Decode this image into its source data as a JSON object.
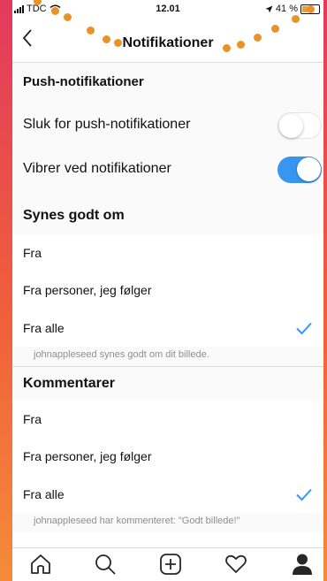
{
  "status_bar": {
    "carrier": "TDC",
    "time": "12.01",
    "battery": "41 %",
    "battery_level": 0.41
  },
  "nav": {
    "title": "Notifikationer"
  },
  "push": {
    "header": "Push-notifikationer",
    "items": [
      {
        "label": "Sluk for push-notifikationer",
        "on": false
      },
      {
        "label": "Vibrer ved notifikationer",
        "on": true
      }
    ]
  },
  "likes": {
    "header": "Synes godt om",
    "options": [
      "Fra",
      "Fra personer, jeg følger",
      "Fra alle"
    ],
    "selected_index": 2,
    "hint": "johnappleseed synes godt om dit billede."
  },
  "comments": {
    "header": "Kommentarer",
    "options": [
      "Fra",
      "Fra personer, jeg følger",
      "Fra alle"
    ],
    "selected_index": 2,
    "hint": "johnappleseed har kommenteret: \"Godt billede!\""
  },
  "colors": {
    "accent": "#3797f0",
    "marker": "#e8932a",
    "background_top": "#e23a5e",
    "background_bottom": "#f58b3a"
  },
  "icons": {
    "back": "chevron-left-icon",
    "check": "checkmark-icon",
    "tabs": [
      "home-icon",
      "search-icon",
      "add-post-icon",
      "heart-icon",
      "profile-icon"
    ]
  }
}
